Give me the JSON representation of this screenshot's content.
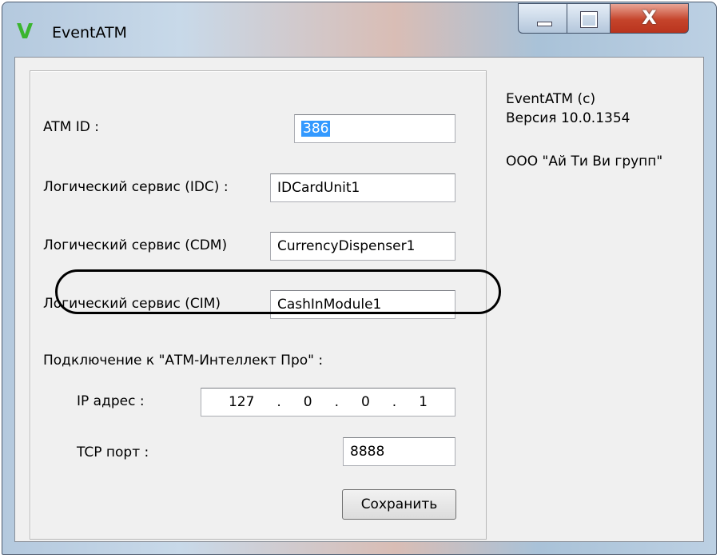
{
  "window": {
    "title": "EventATM",
    "icon": "v-logo-icon",
    "close_glyph": "X"
  },
  "form": {
    "atm_id": {
      "label": "ATM ID :",
      "value": "386"
    },
    "idc": {
      "label": "Логический сервис (IDC) :",
      "value": "IDCardUnit1"
    },
    "cdm": {
      "label": "Логический сервис (CDM)",
      "value": "CurrencyDispenser1"
    },
    "cim": {
      "label": "Логический сервис (CIM)",
      "value": "CashInModule1"
    },
    "connection_label": "Подключение к \"АТМ-Интеллект Про\" :",
    "ip": {
      "label": "IP адрес :",
      "octets": [
        "127",
        "0",
        "0",
        "1"
      ],
      "dots": [
        ".",
        ".",
        "."
      ]
    },
    "tcp": {
      "label": "TCP порт :",
      "value": "8888"
    },
    "save_label": "Сохранить"
  },
  "about": {
    "product": "EventATM (c)",
    "version": "Версия 10.0.1354",
    "company": "ООО \"Ай Ти Ви групп\""
  }
}
